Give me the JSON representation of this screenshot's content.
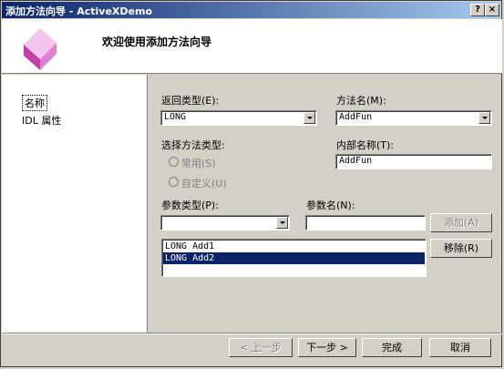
{
  "window": {
    "title": "添加方法向导 - ActiveXDemo",
    "help_label": "?",
    "close_label": "×"
  },
  "header": {
    "welcome": "欢迎使用添加方法向导"
  },
  "sidebar": {
    "items": [
      {
        "label": "名称"
      },
      {
        "label": "IDL 属性"
      }
    ]
  },
  "form": {
    "return_type_label": "返回类型(E):",
    "return_type_value": "LONG",
    "method_name_label": "方法名(M):",
    "method_name_value": "AddFun",
    "method_type_label": "选择方法类型:",
    "radio_common": "常用(S)",
    "radio_custom": "自定义(U)",
    "internal_name_label": "内部名称(T):",
    "internal_name_value": "AddFun",
    "param_type_label": "参数类型(P):",
    "param_type_value": "",
    "param_name_label": "参数名(N):",
    "param_name_value": "",
    "add_button": "添加(A)",
    "remove_button": "移除(R)",
    "params": [
      "LONG Add1",
      "LONG Add2"
    ]
  },
  "footer": {
    "prev_button": "< 上一步",
    "next_button": "下一步 >",
    "finish_button": "完成",
    "cancel_button": "取消"
  },
  "colors": {
    "title_gradient_start": "#0a246a",
    "title_gradient_end": "#a6caf0",
    "selection": "#0a246a",
    "face": "#d4d0c8"
  }
}
